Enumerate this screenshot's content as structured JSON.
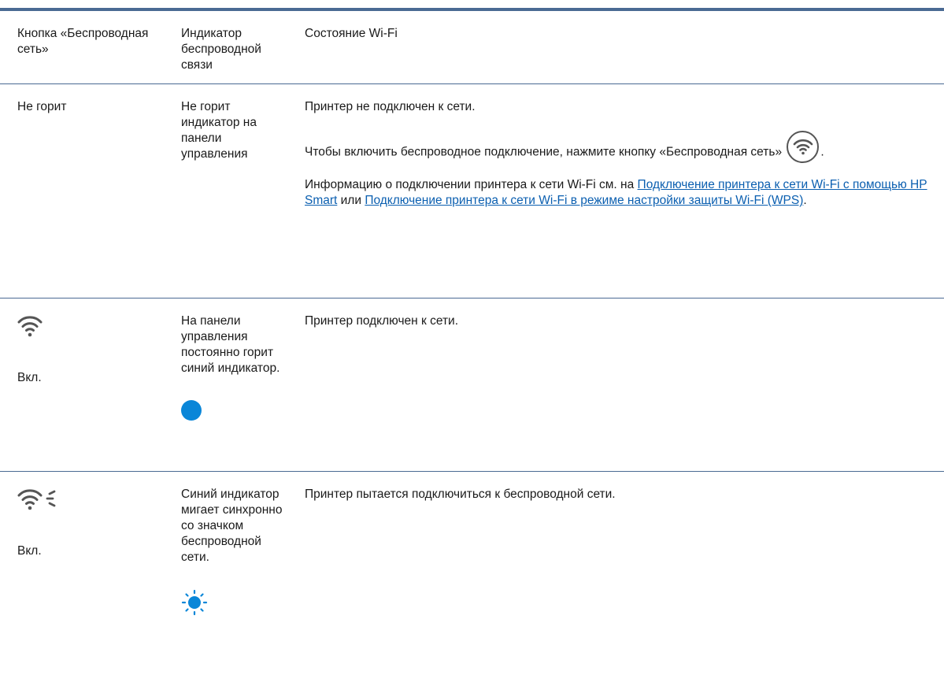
{
  "table": {
    "headers": {
      "button": "Кнопка «Беспроводная сеть»",
      "indicator": "Индикатор беспроводной связи",
      "state": "Состояние Wi-Fi"
    },
    "rows": [
      {
        "button_text": "Не горит",
        "indicator_text": "Не горит индикатор на панели управления",
        "state": {
          "line1": "Принтер не подключен к сети.",
          "line2_before": "Чтобы включить беспроводное подключение, нажмите кнопку «Беспроводная сеть»",
          "line2_after": ".",
          "line2_icon": "wifi-button-icon",
          "info_before": "Информацию о подключении принтера к сети Wi-Fi см. на ",
          "link1": "Подключение принтера к сети Wi-Fi с помощью HP Smart",
          "info_mid": " или ",
          "link2": "Подключение принтера к сети Wi-Fi в режиме настройки защиты Wi-Fi (WPS)",
          "info_after": "."
        }
      },
      {
        "button_icon": "wifi-icon",
        "button_text": "Вкл.",
        "indicator_text": "На панели управления постоянно горит синий индикатор.",
        "indicator_icon": "solid-blue-light-icon",
        "state": {
          "line1": "Принтер подключен к сети."
        }
      },
      {
        "button_icon": "wifi-blinking-icon",
        "button_text": "Вкл.",
        "indicator_text": "Синий индикатор мигает синхронно со значком беспроводной сети.",
        "indicator_icon": "blinking-blue-light-icon",
        "state": {
          "line1": "Принтер пытается подключиться к беспроводной сети."
        }
      }
    ]
  },
  "colors": {
    "rule": "#4a6a93",
    "link": "#0b5fb0",
    "blue_light": "#0a86d8"
  }
}
